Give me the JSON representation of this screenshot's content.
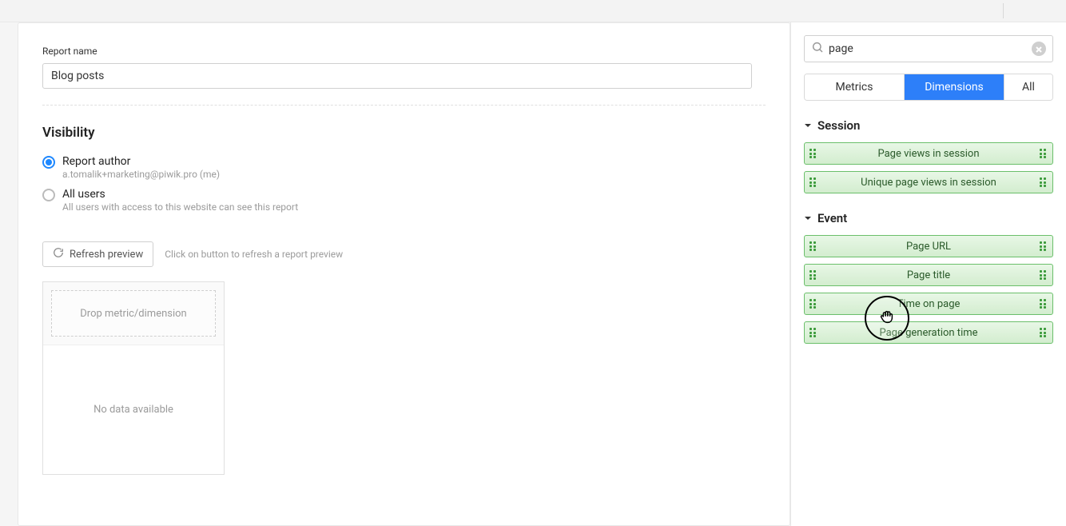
{
  "main": {
    "report_name_label": "Report name",
    "report_name_value": "Blog posts",
    "visibility_title": "Visibility",
    "visibility_options": [
      {
        "label": "Report author",
        "desc": "a.tomalik+marketing@piwik.pro (me)",
        "selected": true
      },
      {
        "label": "All users",
        "desc": "All users with access to this website can see this report",
        "selected": false
      }
    ],
    "refresh_label": "Refresh preview",
    "refresh_hint": "Click on button to refresh a report preview",
    "drop_placeholder": "Drop metric/dimension",
    "no_data_text": "No data available"
  },
  "sidebar": {
    "search_placeholder": "",
    "search_value": "page",
    "tabs": {
      "metrics": "Metrics",
      "dimensions": "Dimensions",
      "all": "All",
      "active": "dimensions"
    },
    "groups": [
      {
        "name": "Session",
        "items": [
          "Page views in session",
          "Unique page views in session"
        ]
      },
      {
        "name": "Event",
        "items": [
          "Page URL",
          "Page title",
          "Time on page",
          "Page generation time"
        ]
      }
    ]
  },
  "cursor": {
    "icon": "grab-hand"
  }
}
